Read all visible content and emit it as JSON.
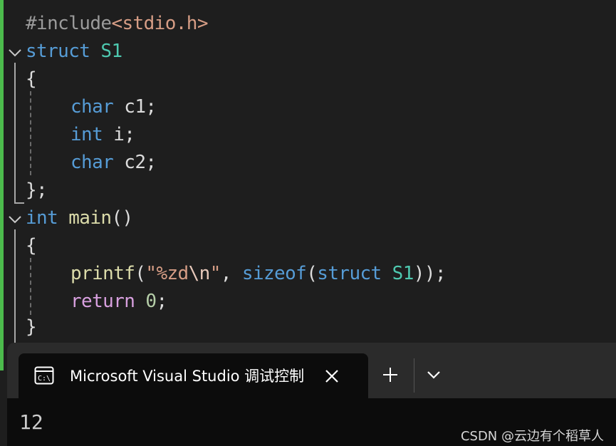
{
  "editor": {
    "lines": {
      "l1": {
        "a": "#include",
        "b": "<stdio.h>"
      },
      "l2": {
        "a": "struct",
        "b": " ",
        "c": "S1"
      },
      "l3": {
        "a": "{"
      },
      "l4": {
        "a": "char",
        "b": " c1;"
      },
      "l5": {
        "a": "int",
        "b": " i;"
      },
      "l6": {
        "a": "char",
        "b": " c2;"
      },
      "l7": {
        "a": "};"
      },
      "l8": {
        "a": "int",
        "b": " ",
        "c": "main",
        "d": "()"
      },
      "l9": {
        "a": "{"
      },
      "l10": {
        "a": "printf",
        "b": "(",
        "c": "\"%zd",
        "d": "\\n",
        "e": "\"",
        "f": ", ",
        "g": "sizeof",
        "h": "(",
        "i": "struct",
        "j": " ",
        "k": "S1",
        "l": "));"
      },
      "l11": {
        "a": "return",
        "b": " ",
        "c": "0",
        "d": ";"
      },
      "l12": {
        "a": "}"
      }
    }
  },
  "terminal": {
    "tab_title": "Microsoft Visual Studio 调试控制台",
    "tab_icon": "console-icon",
    "close_icon": "close-icon",
    "new_tab_icon": "plus-icon",
    "dropdown_icon": "chevron-down-icon",
    "output": "12"
  },
  "watermark": "CSDN @云边有个稻草人",
  "colors": {
    "keyword": "#569cd6",
    "type": "#4ec9b0",
    "function": "#dcdcaa",
    "string": "#d69d85",
    "control": "#d8a0df",
    "number": "#b5cea8",
    "git_added": "#4cbb4c"
  }
}
